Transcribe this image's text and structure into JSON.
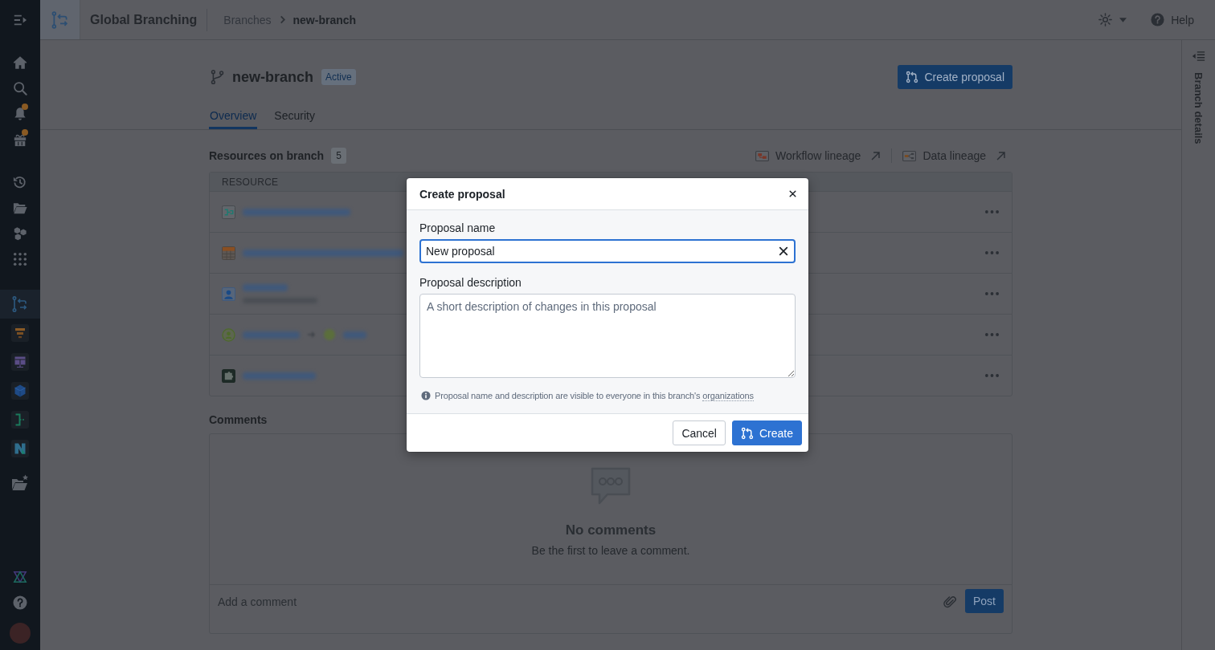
{
  "sidebar": {
    "nav": [
      {
        "kind": "home",
        "badge": false
      },
      {
        "kind": "search",
        "badge": false
      },
      {
        "kind": "notifications",
        "badge": true
      },
      {
        "kind": "gift",
        "badge": true
      }
    ],
    "recent": [
      {
        "kind": "history"
      },
      {
        "kind": "folder"
      },
      {
        "kind": "cubes"
      },
      {
        "kind": "apps"
      }
    ],
    "apps": [
      {
        "kind": "branching",
        "selected": true
      },
      {
        "kind": "funnel",
        "selected": false
      },
      {
        "kind": "monitor",
        "selected": false
      },
      {
        "kind": "cube",
        "selected": false
      },
      {
        "kind": "bracket",
        "selected": false
      },
      {
        "kind": "dataset",
        "selected": false
      },
      {
        "kind": "folder-star",
        "selected": false
      }
    ],
    "footer": [
      {
        "kind": "triangles"
      },
      {
        "kind": "help"
      },
      {
        "kind": "avatar"
      }
    ]
  },
  "header": {
    "title": "Global Branching",
    "breadcrumbs": [
      {
        "label": "Branches",
        "current": false
      },
      {
        "label": "new-branch",
        "current": true
      }
    ],
    "help": "Help"
  },
  "branch": {
    "name": "new-branch",
    "status": "Active",
    "action": "Create proposal",
    "tabs": [
      {
        "label": "Overview",
        "selected": true
      },
      {
        "label": "Security",
        "selected": false
      }
    ]
  },
  "resources": {
    "title": "Resources on branch",
    "count": "5",
    "links": [
      {
        "kind": "workflow",
        "label": "Workflow lineage"
      },
      {
        "kind": "data",
        "label": "Data lineage"
      }
    ],
    "columns": [
      "RESOURCE"
    ],
    "rows": [
      {
        "kind": "pipeline"
      },
      {
        "kind": "table"
      },
      {
        "kind": "ontology"
      },
      {
        "kind": "object"
      },
      {
        "kind": "code"
      }
    ]
  },
  "comments": {
    "title": "Comments",
    "empty_title": "No comments",
    "empty_message": "Be the first to leave a comment.",
    "placeholder": "Add a comment",
    "post": "Post"
  },
  "details_panel": {
    "label": "Branch details"
  },
  "dialog": {
    "title": "Create proposal",
    "fields": [
      {
        "kind": "input",
        "label": "Proposal name",
        "value": "New proposal",
        "focused": true
      },
      {
        "kind": "textarea",
        "label": "Proposal description",
        "placeholder": "A short description of changes in this proposal",
        "focused": false
      }
    ],
    "note": {
      "text": "Proposal name and description are visible to everyone in this branch's",
      "link": "organizations"
    },
    "buttons": [
      {
        "kind": "cancel",
        "label": "Cancel"
      },
      {
        "kind": "submit",
        "label": "Create"
      }
    ]
  }
}
